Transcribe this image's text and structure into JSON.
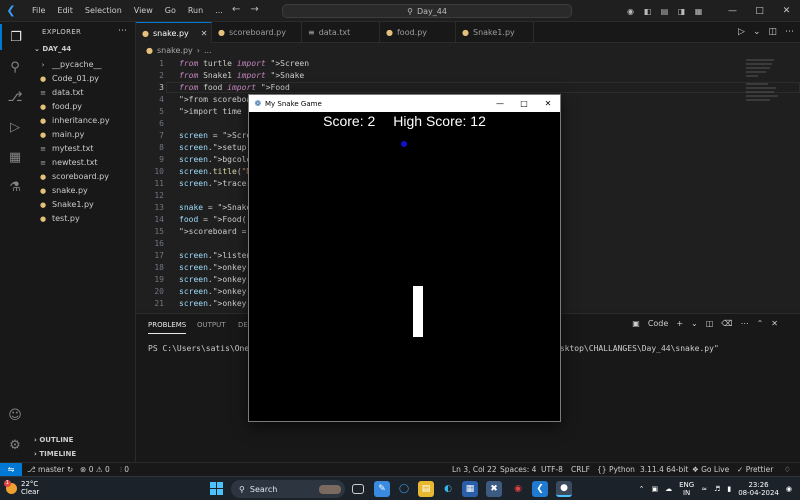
{
  "titlebar": {
    "menu": [
      "File",
      "Edit",
      "Selection",
      "View",
      "Go",
      "Run",
      "..."
    ],
    "search_text": "Day_44"
  },
  "sidebar": {
    "title": "EXPLORER",
    "folder": "DAY_44",
    "files": [
      {
        "name": "__pycache__",
        "icon": "folder-icon"
      },
      {
        "name": "Code_01.py",
        "icon": "python-icon"
      },
      {
        "name": "data.txt",
        "icon": "text-file-icon"
      },
      {
        "name": "food.py",
        "icon": "python-icon"
      },
      {
        "name": "inheritance.py",
        "icon": "python-icon"
      },
      {
        "name": "main.py",
        "icon": "python-icon"
      },
      {
        "name": "mytest.txt",
        "icon": "text-file-icon"
      },
      {
        "name": "newtest.txt",
        "icon": "text-file-icon"
      },
      {
        "name": "scoreboard.py",
        "icon": "python-icon"
      },
      {
        "name": "snake.py",
        "icon": "python-icon"
      },
      {
        "name": "Snake1.py",
        "icon": "python-icon"
      },
      {
        "name": "test.py",
        "icon": "python-icon"
      }
    ],
    "outline": "OUTLINE",
    "timeline": "TIMELINE"
  },
  "tabs": [
    {
      "label": "snake.py",
      "active": true
    },
    {
      "label": "scoreboard.py",
      "active": false
    },
    {
      "label": "data.txt",
      "active": false
    },
    {
      "label": "food.py",
      "active": false
    },
    {
      "label": "Snake1.py",
      "active": false
    }
  ],
  "breadcrumb": {
    "file": "snake.py",
    "more": "..."
  },
  "editor": {
    "current_line": 3,
    "lines": [
      {
        "n": "1",
        "code": "from turtle import Screen"
      },
      {
        "n": "2",
        "code": "from Snake1 import Snake"
      },
      {
        "n": "3",
        "code": "from food import Food"
      },
      {
        "n": "4",
        "code": "from scoreboard"
      },
      {
        "n": "5",
        "code": "import time"
      },
      {
        "n": "6",
        "code": ""
      },
      {
        "n": "7",
        "code": "screen = Screen"
      },
      {
        "n": "8",
        "code": "screen.setup(wi"
      },
      {
        "n": "9",
        "code": "screen.bgcolor("
      },
      {
        "n": "10",
        "code": "screen.title(\"M"
      },
      {
        "n": "11",
        "code": "screen.tracer(0"
      },
      {
        "n": "12",
        "code": ""
      },
      {
        "n": "13",
        "code": "snake = Snake()"
      },
      {
        "n": "14",
        "code": "food = Food()"
      },
      {
        "n": "15",
        "code": "scoreboard = Sc"
      },
      {
        "n": "16",
        "code": ""
      },
      {
        "n": "17",
        "code": "screen.listen()"
      },
      {
        "n": "18",
        "code": "screen.onkey(sn"
      },
      {
        "n": "19",
        "code": "screen.onkey(sn"
      },
      {
        "n": "20",
        "code": "screen.onkey(sn"
      },
      {
        "n": "21",
        "code": "screen.onkey(sn"
      }
    ]
  },
  "panel": {
    "tabs": [
      "PROBLEMS",
      "OUTPUT",
      "DEB"
    ],
    "active_tab": "PROBLEMS",
    "terminal_label": "Code",
    "prompt": "PS C:\\Users\\satis\\OneD",
    "prompt_tail": "esktop\\CHALLANGES\\Day_44\\snake.py\""
  },
  "statusbar": {
    "branch": "master",
    "errors": "0",
    "warnings": "0",
    "ports": "0",
    "position": "Ln 3, Col 22",
    "spaces": "Spaces: 4",
    "encoding": "UTF-8",
    "eol": "CRLF",
    "language": "Python",
    "interpreter": "3.11.4 64-bit",
    "golive": "Go Live",
    "prettier": "Prettier"
  },
  "game": {
    "window_title": "My Snake Game",
    "score_text": "Score: 2",
    "high_score_text": "High Score: 12",
    "food_color": "#1010d0",
    "snake_color": "#ffffff",
    "bg_color": "#000000"
  },
  "taskbar": {
    "temp": "22°C",
    "weather": "Clear",
    "weather_badge": "1",
    "search_label": "Search",
    "lang_top": "ENG",
    "lang_bottom": "IN",
    "time": "23:26",
    "date": "08-04-2024"
  },
  "colors": {
    "accent": "#0078d4",
    "editor_bg": "#1f1f1f",
    "sidebar_bg": "#181818"
  }
}
